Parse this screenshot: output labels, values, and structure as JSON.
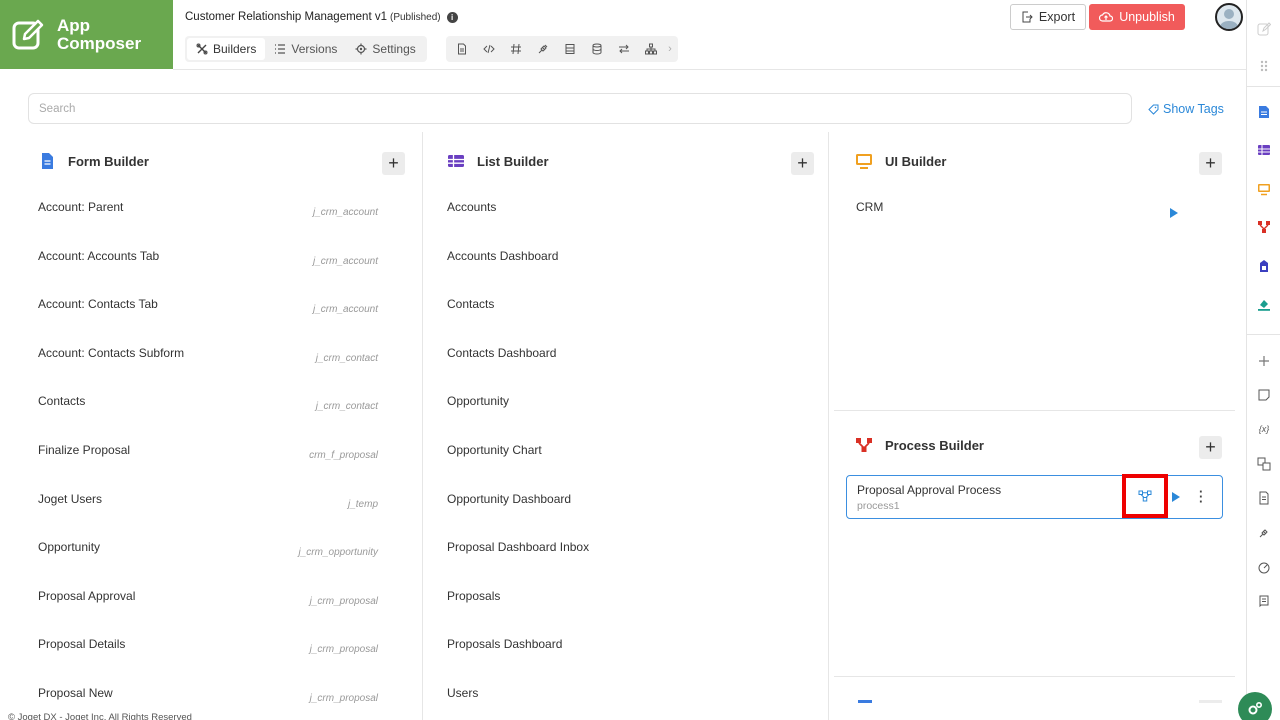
{
  "app": {
    "logo_line1": "App",
    "logo_line2": "Composer",
    "title": "Customer Relationship Management v1",
    "status": "(Published)"
  },
  "tabs": [
    {
      "label": "Builders",
      "icon": "builders-icon",
      "active": true
    },
    {
      "label": "Versions",
      "icon": "list-icon",
      "active": false
    },
    {
      "label": "Settings",
      "icon": "gear-icon",
      "active": false
    }
  ],
  "toolstrip": [
    "file-icon",
    "code-icon",
    "hash-icon",
    "plug-icon",
    "table-icon",
    "database-icon",
    "swap-icon",
    "sitemap-icon"
  ],
  "actions": {
    "export": "Export",
    "unpublish": "Unpublish"
  },
  "search": {
    "placeholder": "Search"
  },
  "show_tags": "Show Tags",
  "form_builder": {
    "title": "Form Builder",
    "items": [
      {
        "name": "Account: Parent",
        "table": "j_crm_account"
      },
      {
        "name": "Account: Accounts Tab",
        "table": "j_crm_account"
      },
      {
        "name": "Account: Contacts Tab",
        "table": "j_crm_account"
      },
      {
        "name": "Account: Contacts Subform",
        "table": "j_crm_contact"
      },
      {
        "name": "Contacts",
        "table": "j_crm_contact"
      },
      {
        "name": "Finalize Proposal",
        "table": "crm_f_proposal"
      },
      {
        "name": "Joget Users",
        "table": "j_temp"
      },
      {
        "name": "Opportunity",
        "table": "j_crm_opportunity"
      },
      {
        "name": "Proposal Approval",
        "table": "j_crm_proposal"
      },
      {
        "name": "Proposal Details",
        "table": "j_crm_proposal"
      },
      {
        "name": "Proposal New",
        "table": "j_crm_proposal"
      }
    ]
  },
  "list_builder": {
    "title": "List Builder",
    "items": [
      "Accounts",
      "Accounts Dashboard",
      "Contacts",
      "Contacts Dashboard",
      "Opportunity",
      "Opportunity Chart",
      "Opportunity Dashboard",
      "Proposal Dashboard Inbox",
      "Proposals",
      "Proposals Dashboard",
      "Users"
    ]
  },
  "ui_builder": {
    "title": "UI Builder",
    "items": [
      "CRM"
    ]
  },
  "process_builder": {
    "title": "Process Builder",
    "items": [
      {
        "name": "Proposal Approval Process",
        "id": "process1"
      }
    ]
  },
  "footer": "© Joget DX - Joget Inc. All Rights Reserved",
  "colors": {
    "brand": "#6aa84f",
    "unpublish": "#f15b5b",
    "link": "#2b88d8",
    "highlight": "#ee0000"
  }
}
